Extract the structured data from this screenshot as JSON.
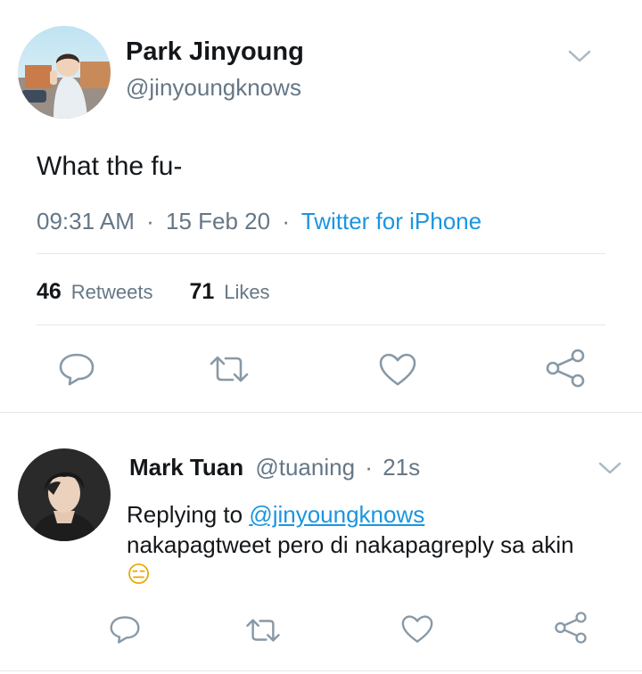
{
  "main_tweet": {
    "author_name": "Park Jinyoung",
    "handle": "@jinyoungknows",
    "text": "What the fu-",
    "time": "09:31 AM",
    "separator_1": "·",
    "date": "15 Feb 20",
    "separator_2": "·",
    "client": "Twitter for iPhone",
    "retweets_count": "46",
    "retweets_label": "Retweets",
    "likes_count": "71",
    "likes_label": "Likes",
    "actions": [
      "reply-icon",
      "retweet-icon",
      "like-icon",
      "share-icon"
    ]
  },
  "reply_tweet": {
    "author_name": "Mark Tuan",
    "handle": "@tuaning",
    "separator": "·",
    "time_ago": "21s",
    "replying_prefix": "Replying to",
    "replying_to": "@jinyoungknows",
    "text": "nakapagtweet pero di nakapagreply sa akin",
    "emoji": "😑",
    "actions": [
      "reply-icon",
      "retweet-icon",
      "like-icon",
      "share-icon"
    ]
  },
  "colors": {
    "text": "#14171a",
    "secondary": "#657786",
    "link": "#1b95e0",
    "divider": "#e1e8ed",
    "icon": "#8899a6"
  }
}
